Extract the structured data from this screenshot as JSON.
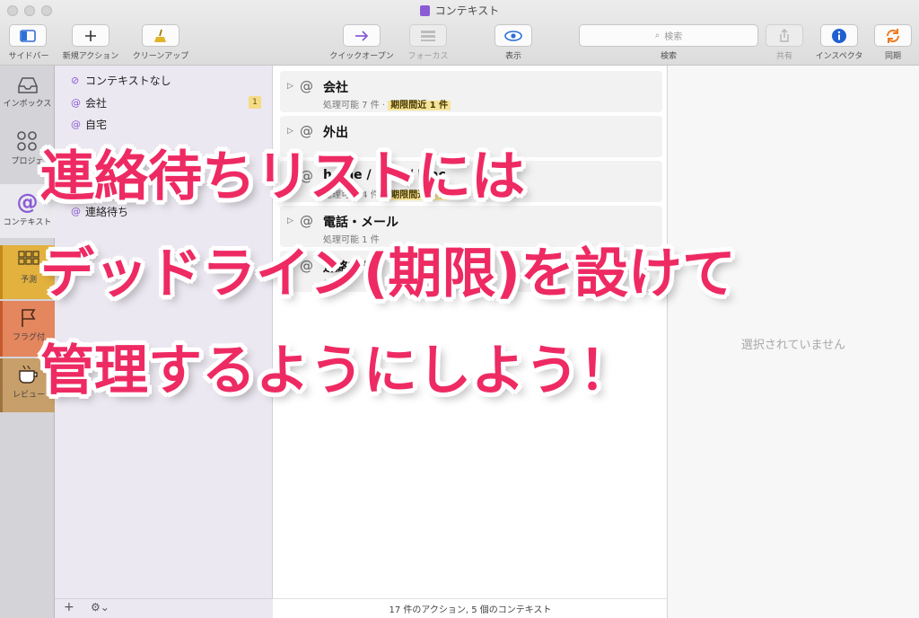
{
  "window": {
    "title": "コンテキスト"
  },
  "toolbar": {
    "sidebar": "サイドバー",
    "new_action": "新規アクション",
    "cleanup": "クリーンアップ",
    "quick_open": "クイックオープン",
    "focus": "フォーカス",
    "view": "表示",
    "search_placeholder": "検索",
    "search_label": "検索",
    "share": "共有",
    "inspector": "インスペクタ",
    "sync": "同期"
  },
  "nav": {
    "inbox": "インボックス",
    "projects": "プロジェ",
    "contexts": "コンテキスト",
    "forecast": "予測",
    "flagged": "フラグ付",
    "review": "レビュー"
  },
  "sidebar": {
    "items": [
      {
        "label": "コンテキストなし"
      },
      {
        "label": "会社",
        "badge": "1"
      },
      {
        "label": "自宅"
      },
      {
        "label": "連絡待ち"
      }
    ],
    "footer_add": "+",
    "footer_gear": "⚙︎⌄"
  },
  "outline": {
    "rows": [
      {
        "name": "会社",
        "sub": "処理可能 7 件 · ",
        "due": "期限間近 1 件"
      },
      {
        "name": "外出",
        "sub": "",
        "due": ""
      },
      {
        "name": "home / Mac / Mac",
        "sub": "処理可能 4 件 · ",
        "due": "期限間近 3 件"
      },
      {
        "name": "電話・メール",
        "sub": "処理可能 1 件",
        "due": ""
      },
      {
        "name": "連絡待ち",
        "sub": "処理",
        "due": ""
      }
    ],
    "status": "17 件のアクション, 5 個のコンテキスト"
  },
  "inspector": {
    "empty": "選択されていません"
  },
  "caption": {
    "line1": "連絡待ちリストには",
    "line2": "デッドライン(期限)を設けて",
    "line3": "管理するようにしよう！"
  },
  "colors": {
    "accent": "#8b5cd6",
    "caption": "#ee2a63",
    "due_badge": "#f6e39a"
  }
}
